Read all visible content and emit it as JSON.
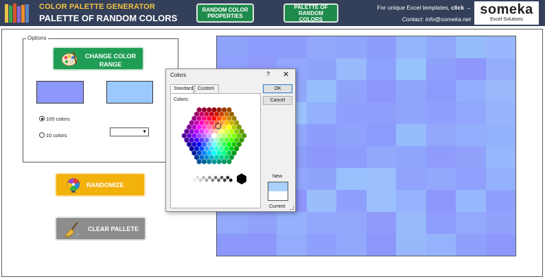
{
  "header": {
    "app_title": "COLOR PALETTE GENERATOR",
    "sheet_title": "PALETTE OF RANDOM COLORS",
    "nav_random_properties": "RANDOM COLOR PROPERTIES",
    "nav_palette": "PALETTE OF RANDOM COLORS",
    "promo_text": "For unique Excel templates,",
    "promo_link": "click →",
    "contact": "Contact: info@someka.net",
    "brand_name": "someka",
    "brand_sub": "Excel Solutions"
  },
  "options": {
    "legend": "Options",
    "change_color_range_label": "CHANGE COLOR RANGE",
    "start_color": "#8c98fc",
    "end_color": "#9bc8fd",
    "radio_100_label": "100 colors",
    "radio_10_label": "10 colors",
    "selected_count": "100 colors",
    "dropdown_value": ""
  },
  "actions": {
    "randomize_label": "RANDOMIZE",
    "clear_label": "CLEAR PALLETE"
  },
  "palette_grid": {
    "rows": 10,
    "cols": 10,
    "colors": [
      "#8ea2fc",
      "#8c9cfc",
      "#8e9cfc",
      "#93a8fc",
      "#8fa6fc",
      "#8e9dfb",
      "#94b5fc",
      "#90a8fc",
      "#96bcfc",
      "#9ab6fc",
      "#90a0fc",
      "#8f9afb",
      "#91a6fc",
      "#8ea3fc",
      "#98b9fc",
      "#8da2fc",
      "#96c2fd",
      "#8fa0fc",
      "#8e97fb",
      "#94aefc",
      "#95b2fc",
      "#96bafc",
      "#92a8fc",
      "#96bdfc",
      "#90a3fc",
      "#8d97fb",
      "#91a4fc",
      "#8c9afc",
      "#92adfc",
      "#9ab8fc",
      "#8fa3fc",
      "#8f9bfb",
      "#9cc2fc",
      "#92b0fc",
      "#8fa0fc",
      "#8f9efb",
      "#90a4fc",
      "#8ea0fc",
      "#91a6fc",
      "#97b3fc",
      "#8f9cfb",
      "#92a9fc",
      "#93a8fc",
      "#8d9dfb",
      "#8fa2fc",
      "#8d9bfc",
      "#97bcfc",
      "#92a6fc",
      "#93aefc",
      "#93b2fc",
      "#9cc3fd",
      "#97b8fc",
      "#8e9efb",
      "#8d98fb",
      "#8e9dfc",
      "#92a8fc",
      "#90a6fc",
      "#8f9cfb",
      "#91a1fc",
      "#96b7fc",
      "#93abfc",
      "#96b6fc",
      "#91a6fc",
      "#8fa3fc",
      "#9abffd",
      "#9bbffc",
      "#91a3fc",
      "#91a8fc",
      "#91a0fc",
      "#94b2fc",
      "#8e9ffc",
      "#90a4fc",
      "#8c96fb",
      "#9abdfc",
      "#8f9ffc",
      "#9bbffc",
      "#96b2fc",
      "#8d97fb",
      "#97b8fc",
      "#8fa0fc",
      "#92a9fc",
      "#91a2fc",
      "#94b1fc",
      "#92a8fc",
      "#92a7fc",
      "#8f9bfb",
      "#98b9fc",
      "#8f9dfc",
      "#93a9fc",
      "#91a2fc",
      "#8d98fb",
      "#8c96fb",
      "#94acfc",
      "#8e9ffc",
      "#92a8fc",
      "#8c97fb",
      "#98b8fc",
      "#95b3fc",
      "#8e9ffc",
      "#8c98fb"
    ]
  },
  "colors_dialog": {
    "title": "Colors",
    "help": "?",
    "close": "✕",
    "tab_standard": "Standard",
    "tab_custom": "Custom",
    "colors_label": "Colors:",
    "ok_label": "OK",
    "cancel_label": "Cancel",
    "new_label": "New",
    "current_label": "Current",
    "new_color": "#a8d0fb",
    "current_color": "#ffffff"
  },
  "icons": {
    "logo": "books-icon",
    "change_range": "palette-icon",
    "randomize": "spin-wheel-icon",
    "clear": "broom-icon"
  }
}
